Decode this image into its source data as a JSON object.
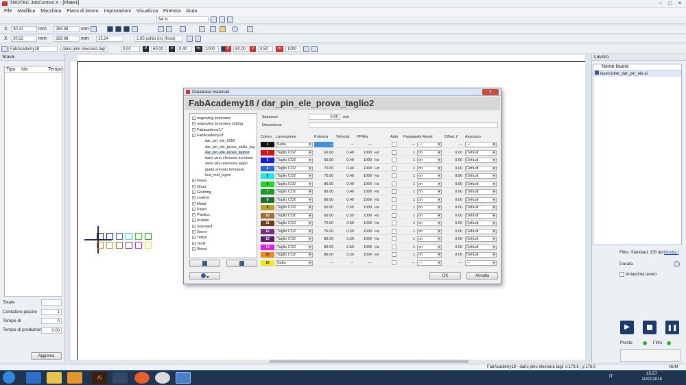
{
  "app": {
    "title": "TROTEC JobControl X - [Plate1]"
  },
  "menu": [
    "File",
    "Modifica",
    "Macchina",
    "Piano di lavoro",
    "Impostazioni",
    "Visualizza",
    "Finestra",
    "Aiuto"
  ],
  "toolbar": {
    "zoom": "64 %",
    "x1": "30.22",
    "x1_unit": "mm",
    "y1": "263.98",
    "y1_unit": "mm",
    "x2": "30.22",
    "x2_unit": "mm",
    "y2": "263.98",
    "y2_unit": "mm",
    "thick": "15.24",
    "thick_unit": "2.85 pollici (in) (fisso)",
    "material": "FabAcademy18",
    "material_sub": "dario pino eleonora tagl",
    "p1": "0.00",
    "p1b": "60.00",
    "v_val": "0.40",
    "hz_val": "1000",
    "p2": "80.00",
    "v2": "0.50",
    "hz2": "1000"
  },
  "left_panel": {
    "title": "Stava",
    "cols": [
      "Tipo",
      "Idx",
      "Tempo"
    ],
    "totale": "Totale",
    "contatore": "Contatore piastre",
    "contatore_val": "1",
    "tempo": "Tempo di",
    "tempo_val": "0",
    "produzione": "Tempo di produzione",
    "produzione_val": "0:00",
    "aggiorna": "Aggiorna"
  },
  "right_panel": {
    "title": "Lavoro",
    "col": "Nome lavoro",
    "job": "lasercutter_dar_pin_ele.ai",
    "filtro": "Filtro: Standard; 333 dpi",
    "mostra": "Mostra l",
    "durata": "Durata",
    "anteprima": "Anteprima lavoro",
    "pronto": "Pronto",
    "filtro2": "Filtro"
  },
  "status": {
    "text": "FabAcademy18 - dario pino eleonora tagli",
    "coords": "x:179.6 ; y:176.0",
    "num": "NUM"
  },
  "taskbar": {
    "lang": "IT",
    "time": "15:57",
    "date": "11/02/2018"
  },
  "dialog": {
    "title": "Database materiali",
    "header": "FabAcademy18 / dar_pin_ele_prova_taglio2",
    "tree": [
      {
        "label": "engraving laminates",
        "child": false,
        "pm": "+"
      },
      {
        "label": "engraving laminates cutting",
        "child": false,
        "pm": "+"
      },
      {
        "label": "Fabacademy17",
        "child": false,
        "pm": "+"
      },
      {
        "label": "FabAcademy18",
        "child": false,
        "pm": "−"
      },
      {
        "label": "dar_pin_ele_k050",
        "child": true
      },
      {
        "label": "dar_pin_ele_prova_stella_tag",
        "child": true
      },
      {
        "label": "dar_pin_ele_prova_taglio2",
        "child": true
      },
      {
        "label": "dario pino eleonora incisione",
        "child": true
      },
      {
        "label": "dario pino eleonora taglio",
        "child": true
      },
      {
        "label": "giada antonio tommaso",
        "child": true
      },
      {
        "label": "test_mdf_legno",
        "child": true
      },
      {
        "label": "Flavio",
        "child": false,
        "pm": "+"
      },
      {
        "label": "Glass",
        "child": false,
        "pm": "+"
      },
      {
        "label": "Goldring",
        "child": false,
        "pm": "+"
      },
      {
        "label": "Leather",
        "child": false,
        "pm": "+"
      },
      {
        "label": "Metal",
        "child": false,
        "pm": "+"
      },
      {
        "label": "Paper",
        "child": false,
        "pm": "+"
      },
      {
        "label": "Plastics",
        "child": false,
        "pm": "+"
      },
      {
        "label": "Rubber",
        "child": false,
        "pm": "+"
      },
      {
        "label": "Standard",
        "child": false,
        "pm": "+"
      },
      {
        "label": "Stone",
        "child": false,
        "pm": "+"
      },
      {
        "label": "Teflon",
        "child": false,
        "pm": "+"
      },
      {
        "label": "Textil",
        "child": false,
        "pm": "+"
      },
      {
        "label": "Wood",
        "child": false,
        "pm": "+"
      }
    ],
    "spessore_label": "Spessore",
    "spessore_val": "0.00",
    "spessore_unit": "mm",
    "descrizione_label": "Descrizione",
    "cols": [
      "Colore",
      "Lavorazione",
      "Potenza",
      "Velocità",
      "PPI/Hz",
      "",
      "Auto",
      "Passate",
      "Air Assist",
      "Offset Z",
      "Avanzato"
    ],
    "rows": [
      {
        "n": "1",
        "color": "#111111",
        "fg": "#ffffff",
        "lav": "Salta",
        "pot": "---",
        "vel": "---",
        "ppi": "---",
        "unit": "",
        "pass": "---",
        "air": "---",
        "off": "---",
        "adv": "---"
      },
      {
        "n": "2",
        "color": "#e01010",
        "fg": "#ffffff",
        "lav": "Taglio CO2",
        "pot": "60.00",
        "vel": "0.40",
        "ppi": "1000",
        "unit": "Hz",
        "pass": "1",
        "air": "on",
        "off": "0.00",
        "adv": "Default"
      },
      {
        "n": "3",
        "color": "#1a1ad8",
        "fg": "#ffffff",
        "lav": "Taglio CO2",
        "pot": "65.00",
        "vel": "0.40",
        "ppi": "1000",
        "unit": "Hz",
        "pass": "1",
        "air": "on",
        "off": "0.00",
        "adv": "Default"
      },
      {
        "n": "4",
        "color": "#3466c8",
        "fg": "#ffffff",
        "lav": "Taglio CO2",
        "pot": "70.00",
        "vel": "0.40",
        "ppi": "1000",
        "unit": "Hz",
        "pass": "1",
        "air": "on",
        "off": "0.00",
        "adv": "Default"
      },
      {
        "n": "5",
        "color": "#19e8e8",
        "fg": "#222222",
        "lav": "Taglio CO2",
        "pot": "75.00",
        "vel": "0.40",
        "ppi": "1000",
        "unit": "Hz",
        "pass": "1",
        "air": "on",
        "off": "0.00",
        "adv": "Default"
      },
      {
        "n": "6",
        "color": "#22d622",
        "fg": "#222222",
        "lav": "Taglio CO2",
        "pot": "80.00",
        "vel": "0.40",
        "ppi": "1000",
        "unit": "Hz",
        "pass": "1",
        "air": "on",
        "off": "0.00",
        "adv": "Default"
      },
      {
        "n": "7",
        "color": "#1c9a2a",
        "fg": "#ffffff",
        "lav": "Taglio CO2",
        "pot": "85.00",
        "vel": "0.40",
        "ppi": "1000",
        "unit": "Hz",
        "pass": "1",
        "air": "on",
        "off": "0.00",
        "adv": "Default"
      },
      {
        "n": "8",
        "color": "#1d6b2a",
        "fg": "#ffffff",
        "lav": "Taglio CO2",
        "pot": "90.00",
        "vel": "0.40",
        "ppi": "1000",
        "unit": "Hz",
        "pass": "1",
        "air": "on",
        "off": "0.00",
        "adv": "Default"
      },
      {
        "n": "9",
        "color": "#b9a02a",
        "fg": "#222222",
        "lav": "Taglio CO2",
        "pot": "60.00",
        "vel": "0.50",
        "ppi": "1000",
        "unit": "Hz",
        "pass": "1",
        "air": "on",
        "off": "0.00",
        "adv": "Default"
      },
      {
        "n": "10",
        "color": "#a36a3a",
        "fg": "#ffffff",
        "lav": "Taglio CO2",
        "pot": "65.00",
        "vel": "0.50",
        "ppi": "1000",
        "unit": "Hz",
        "pass": "1",
        "air": "on",
        "off": "0.00",
        "adv": "Default"
      },
      {
        "n": "11",
        "color": "#6b3d1f",
        "fg": "#ffffff",
        "lav": "Taglio CO2",
        "pot": "70.00",
        "vel": "0.50",
        "ppi": "1000",
        "unit": "Hz",
        "pass": "1",
        "air": "on",
        "off": "0.00",
        "adv": "Default"
      },
      {
        "n": "12",
        "color": "#7a2a8a",
        "fg": "#ffffff",
        "lav": "Taglio CO2",
        "pot": "75.00",
        "vel": "0.50",
        "ppi": "1000",
        "unit": "Hz",
        "pass": "1",
        "air": "on",
        "off": "0.00",
        "adv": "Default"
      },
      {
        "n": "13",
        "color": "#5a1f6a",
        "fg": "#ffffff",
        "lav": "Taglio CO2",
        "pot": "80.00",
        "vel": "0.50",
        "ppi": "1000",
        "unit": "Hz",
        "pass": "1",
        "air": "on",
        "off": "0.00",
        "adv": "Default"
      },
      {
        "n": "14",
        "color": "#e61ae6",
        "fg": "#ffffff",
        "lav": "Taglio CO2",
        "pot": "85.00",
        "vel": "0.50",
        "ppi": "1000",
        "unit": "Hz",
        "pass": "1",
        "air": "on",
        "off": "0.00",
        "adv": "Default"
      },
      {
        "n": "15",
        "color": "#f08a1a",
        "fg": "#222222",
        "lav": "Taglio CO2",
        "pot": "90.00",
        "vel": "0.50",
        "ppi": "1000",
        "unit": "Hz",
        "pass": "1",
        "air": "on",
        "off": "0.00",
        "adv": "Default"
      },
      {
        "n": "16",
        "color": "#f2ea12",
        "fg": "#222222",
        "lav": "Salta",
        "pot": "---",
        "vel": "---",
        "ppi": "---",
        "unit": "",
        "pass": "---",
        "air": "---",
        "off": "---",
        "adv": "---"
      }
    ],
    "ok": "OK",
    "annulla": "Annulla"
  }
}
